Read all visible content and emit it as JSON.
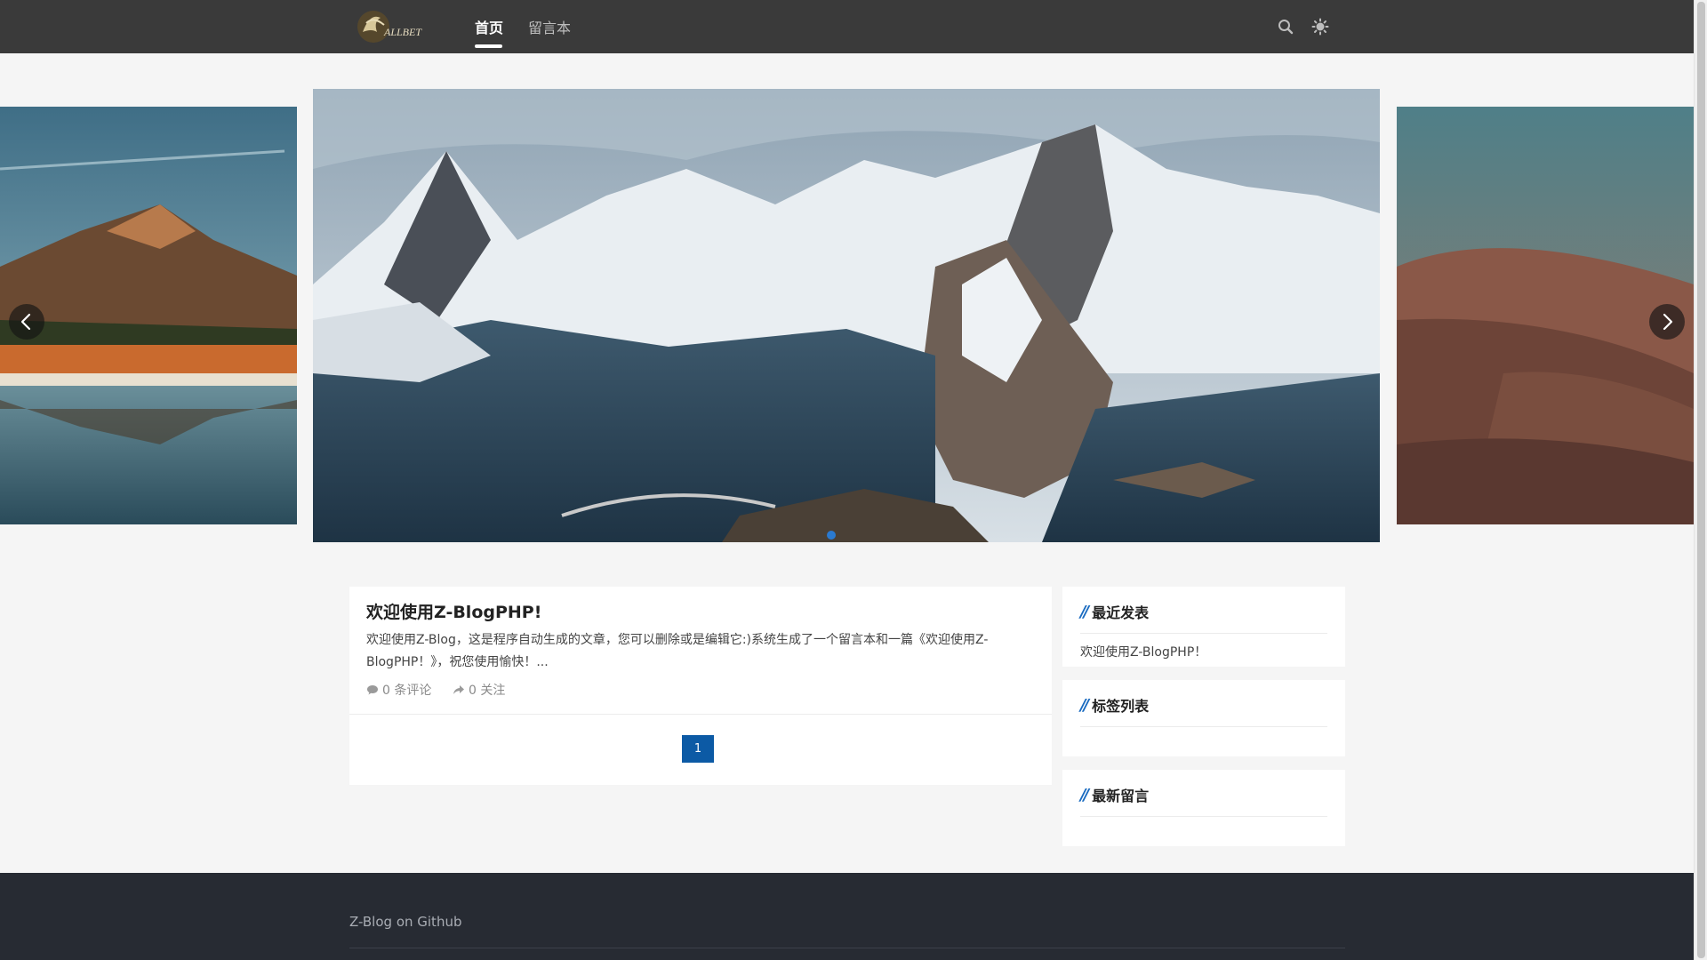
{
  "header": {
    "logo_alt": "ALLBET",
    "nav": [
      {
        "label": "首页",
        "active": true
      },
      {
        "label": "留言本",
        "active": false
      }
    ],
    "icons": [
      "search-icon",
      "sun-icon"
    ]
  },
  "slider": {
    "slides": [
      "autumn-mountain-lake",
      "snowy-mountain-fjord",
      "desert-dunes"
    ],
    "active_index": 1,
    "prev_icon": "chevron-left-icon",
    "next_icon": "chevron-right-icon"
  },
  "post": {
    "title": "欢迎使用Z-BlogPHP!",
    "excerpt": "欢迎使用Z-Blog，这是程序自动生成的文章，您可以删除或是编辑它:)系统生成了一个留言本和一篇《欢迎使用Z-BlogPHP！》，祝您使用愉快！...",
    "comments_label": "0 条评论",
    "follows_label": "0 关注",
    "comment_icon": "comment-icon",
    "share_icon": "share-icon"
  },
  "pagination": {
    "current": "1"
  },
  "sidebar": {
    "recent": {
      "title": "最近发表",
      "items": [
        "欢迎使用Z-BlogPHP！"
      ]
    },
    "tags": {
      "title": "标签列表"
    },
    "comments": {
      "title": "最新留言"
    }
  },
  "footer": {
    "link": "Z-Blog on Github"
  },
  "colors": {
    "accent": "#0c5aa5",
    "header_bg": "#3a3a3a",
    "footer_bg": "#272b33"
  }
}
